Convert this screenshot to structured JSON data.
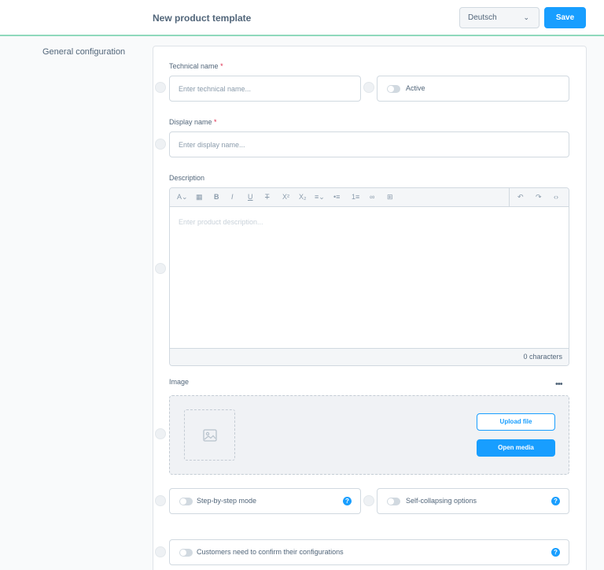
{
  "header": {
    "title": "New product template",
    "language": "Deutsch",
    "save_label": "Save"
  },
  "sidebar": {
    "section_title": "General configuration"
  },
  "form": {
    "technical_name": {
      "label": "Technical name",
      "required_mark": "*",
      "placeholder": "Enter technical name..."
    },
    "active": {
      "label": "Active",
      "enabled": false
    },
    "display_name": {
      "label": "Display name",
      "required_mark": "*",
      "placeholder": "Enter display name..."
    },
    "description": {
      "label": "Description",
      "placeholder": "Enter product description...",
      "char_count": "0 characters",
      "toolbar_icons": [
        "text-style-icon",
        "clear-format-icon",
        "bold-icon",
        "italic-icon",
        "underline-icon",
        "strikethrough-icon",
        "superscript-icon",
        "subscript-icon",
        "align-icon",
        "unordered-list-icon",
        "ordered-list-icon",
        "link-icon",
        "table-icon",
        "undo-icon",
        "redo-icon",
        "code-view-icon"
      ]
    },
    "image": {
      "label": "Image",
      "upload_label": "Upload file",
      "open_media_label": "Open media"
    },
    "step_by_step": {
      "label": "Step-by-step mode",
      "enabled": false
    },
    "self_collapsing": {
      "label": "Self-collapsing options",
      "enabled": false
    },
    "confirm": {
      "label": "Customers need to confirm their configurations",
      "enabled": false
    }
  },
  "colors": {
    "accent": "#189eff",
    "header_border": "#8fd9bc",
    "required": "#de294c"
  }
}
